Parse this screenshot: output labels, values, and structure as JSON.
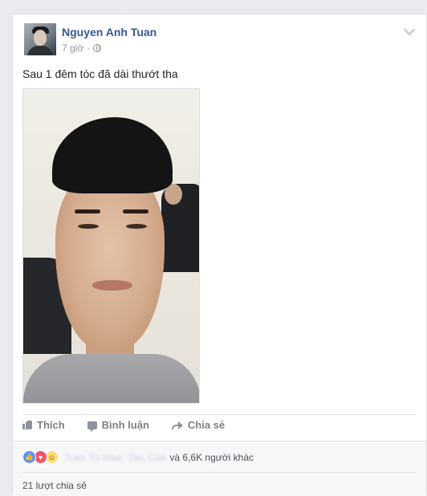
{
  "post": {
    "author": "Nguyen Anh Tuan",
    "time": "7 giờ",
    "separator": "·",
    "privacy_icon": "globe-icon",
    "text": "Sau 1 đêm tóc đã dài thướt tha"
  },
  "actions": {
    "like": "Thích",
    "comment": "Bình luận",
    "share": "Chia sẻ"
  },
  "reactions": {
    "icons": [
      "like-icon",
      "love-icon",
      "haha-icon"
    ],
    "names": "Tran Tu Hao, Tan Cao",
    "count": "và 6,6K người khác"
  },
  "shares": "21 lượt chia sẻ",
  "colors": {
    "author": "#365899",
    "like": "#5890ff",
    "love": "#f25268",
    "haha": "#ffd972"
  }
}
